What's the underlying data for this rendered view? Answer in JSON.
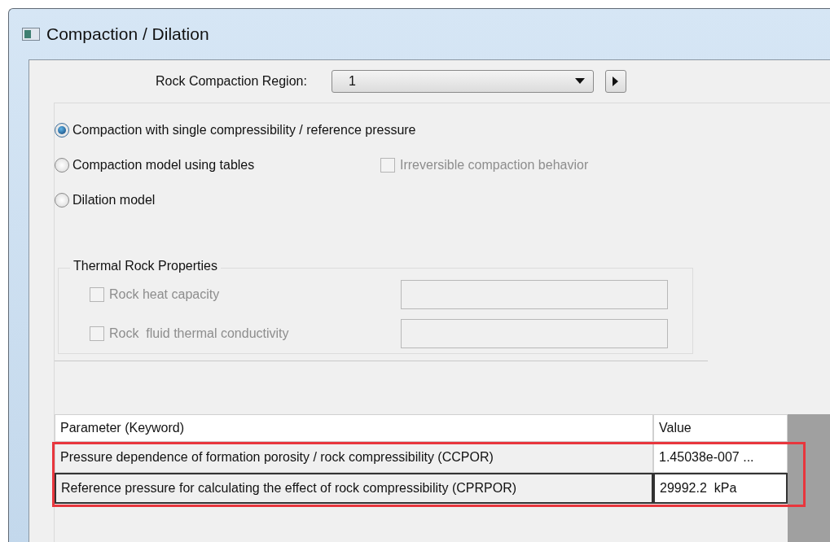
{
  "window": {
    "title": "Compaction / Dilation"
  },
  "region": {
    "label": "Rock Compaction Region:",
    "value": "1"
  },
  "models": [
    {
      "label": "Compaction with single compressibility / reference pressure",
      "selected": true
    },
    {
      "label": "Compaction model using tables",
      "selected": false
    },
    {
      "label": "Dilation model",
      "selected": false
    }
  ],
  "irreversible": {
    "label": "Irreversible compaction behavior",
    "checked": false,
    "disabled": true
  },
  "thermal": {
    "title": "Thermal Rock Properties",
    "items": [
      {
        "label": "Rock heat capacity",
        "checked": false,
        "disabled": true
      },
      {
        "label": "Rock  fluid thermal conductivity",
        "checked": false,
        "disabled": true
      }
    ]
  },
  "table": {
    "columns": [
      "Parameter (Keyword)",
      "Value"
    ],
    "rows": [
      {
        "parameter": "Pressure dependence of formation porosity / rock compressibility (CCPOR)",
        "value": "1.45038e-007 ...",
        "selected": false
      },
      {
        "parameter": "Reference pressure for calculating the effect of rock compressibility (CPRPOR)",
        "value": "29992.2  kPa",
        "selected": true
      }
    ]
  }
}
